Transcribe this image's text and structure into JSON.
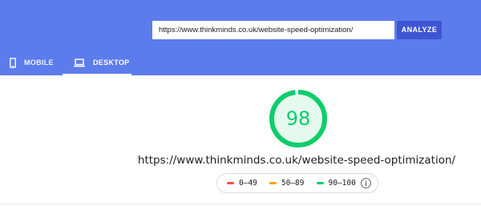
{
  "search": {
    "value": "https://www.thinkminds.co.uk/website-speed-optimization/",
    "button_label": "ANALYZE"
  },
  "tabs": [
    {
      "label": "MOBILE",
      "icon": "smartphone-icon",
      "selected": false
    },
    {
      "label": "DESKTOP",
      "icon": "laptop-icon",
      "selected": true
    }
  ],
  "report": {
    "score": "98",
    "score_fraction": 0.98,
    "tested_url": "https://www.thinkminds.co.uk/website-speed-optimization/"
  },
  "legend": [
    {
      "label": "0–49",
      "color": "#ff4e42"
    },
    {
      "label": "50–89",
      "color": "#ffa400"
    },
    {
      "label": "90–100",
      "color": "#0cce6b"
    }
  ],
  "colors": {
    "header": "#5c7cec",
    "button": "#3f56d3",
    "score_good": "#0cce6b",
    "score_track": "#e6f9ef"
  }
}
